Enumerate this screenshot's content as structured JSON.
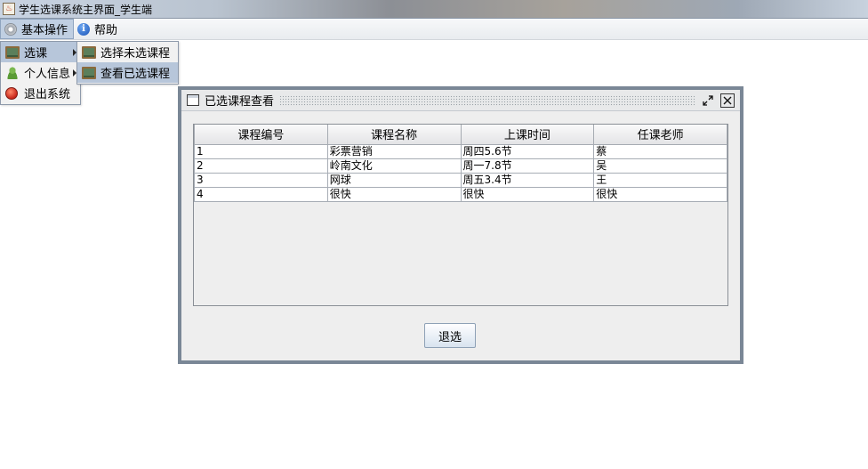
{
  "window": {
    "title": "学生选课系统主界面_学生端"
  },
  "menubar": {
    "items": [
      {
        "label": "基本操作",
        "icon": "gear-icon"
      },
      {
        "label": "帮助",
        "icon": "info-icon"
      }
    ]
  },
  "basic_menu": {
    "items": [
      {
        "label": "选课",
        "icon": "board-icon",
        "has_submenu": true
      },
      {
        "label": "个人信息",
        "icon": "person-icon",
        "has_submenu": true
      },
      {
        "label": "退出系统",
        "icon": "exit-icon",
        "has_submenu": false
      }
    ]
  },
  "select_submenu": {
    "items": [
      {
        "label": "选择未选课程",
        "icon": "board-icon"
      },
      {
        "label": "查看已选课程",
        "icon": "board-icon"
      }
    ]
  },
  "internal_frame": {
    "title": "已选课程查看",
    "columns": [
      "课程编号",
      "课程名称",
      "上课时间",
      "任课老师"
    ],
    "rows": [
      [
        "1",
        "彩票营销",
        "周四5.6节",
        "蔡"
      ],
      [
        "2",
        "岭南文化",
        "周一7.8节",
        "吴"
      ],
      [
        "3",
        "网球",
        "周五3.4节",
        "王"
      ],
      [
        "4",
        "很快",
        "很快",
        "很快"
      ]
    ],
    "drop_button": "退选"
  },
  "colors": {
    "menu_highlight": "#b7c6da",
    "frame_border": "#7a8796"
  }
}
